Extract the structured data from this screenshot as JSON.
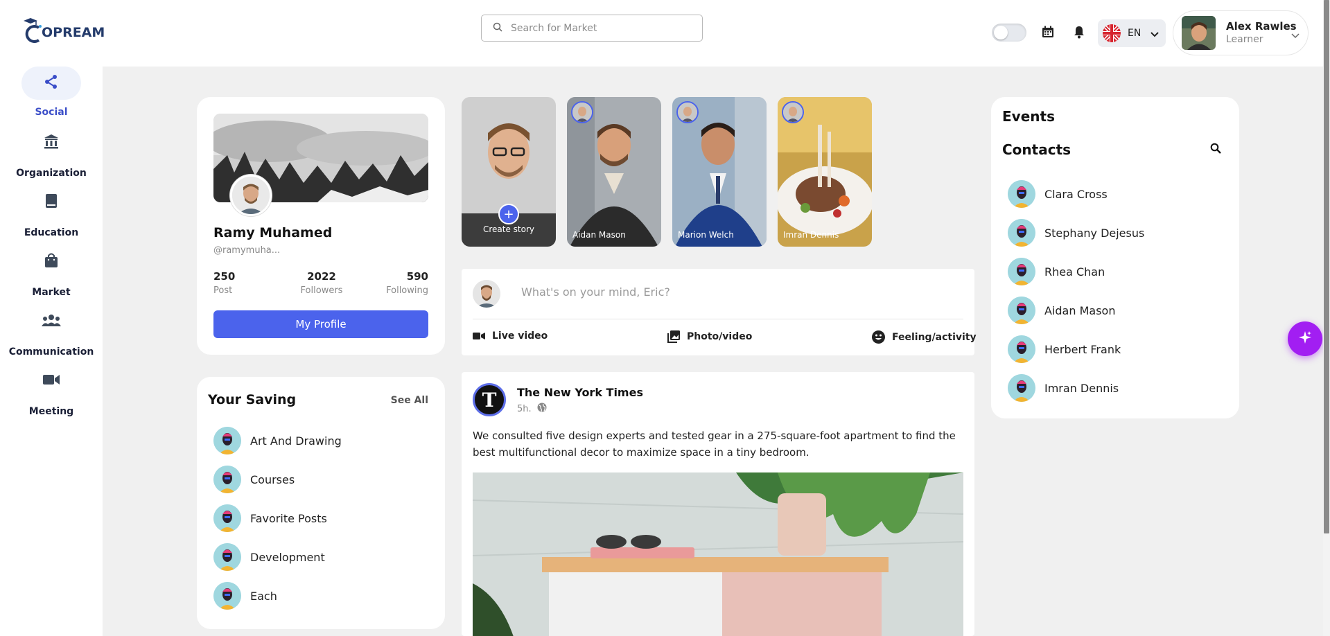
{
  "app": {
    "logo_text": "OPREAM"
  },
  "header": {
    "search_placeholder": "Search for Market",
    "language": "EN",
    "user": {
      "name": "Alex Rawles",
      "role": "Learner"
    }
  },
  "sidebar": {
    "items": [
      {
        "label": "Social",
        "icon": "share-icon",
        "active": true
      },
      {
        "label": "Organization",
        "icon": "bank-icon",
        "active": false
      },
      {
        "label": "Education",
        "icon": "book-icon",
        "active": false
      },
      {
        "label": "Market",
        "icon": "shopping-bag-icon",
        "active": false
      },
      {
        "label": "Communication",
        "icon": "users-icon",
        "active": false
      },
      {
        "label": "Meeting",
        "icon": "video-icon",
        "active": false
      }
    ]
  },
  "profile": {
    "name": "Ramy Muhamed",
    "handle": "@ramymuha...",
    "stats": [
      {
        "value": "250",
        "label": "Post"
      },
      {
        "value": "2022",
        "label": "Followers"
      },
      {
        "value": "590",
        "label": "Following"
      }
    ],
    "button": "My Profile"
  },
  "saving": {
    "title": "Your Saving",
    "see_all": "See All",
    "items": [
      "Art And Drawing",
      "Courses",
      "Favorite Posts",
      "Development",
      "Each"
    ]
  },
  "stories": {
    "create_label": "Create story",
    "create_plus": "+",
    "items": [
      {
        "name": "Aidan Mason"
      },
      {
        "name": "Marion Welch"
      },
      {
        "name": "Imran Dennis"
      }
    ]
  },
  "composer": {
    "placeholder": "What's on your mind, Eric?",
    "actions": [
      {
        "label": "Live video",
        "icon": "video-camera-icon"
      },
      {
        "label": "Photo/video",
        "icon": "photo-library-icon"
      },
      {
        "label": "Feeling/activity",
        "icon": "smiley-icon"
      }
    ]
  },
  "post": {
    "author": "The New York Times",
    "logo_letter": "T",
    "time": "5h.",
    "text": "We consulted five design experts and tested gear in a 275-square-foot apartment to find the best multifunctional decor to maximize space in a tiny bedroom."
  },
  "right_panel": {
    "events_title": "Events",
    "contacts_title": "Contacts",
    "contacts": [
      "Clara Cross",
      "Stephany Dejesus",
      "Rhea Chan",
      "Aidan Mason",
      "Herbert Frank",
      "Imran Dennis"
    ]
  },
  "colors": {
    "accent": "#4b63ec",
    "active_nav": "#3b4ec8",
    "fab": "#a21ef2",
    "background": "#f0f0f0"
  }
}
